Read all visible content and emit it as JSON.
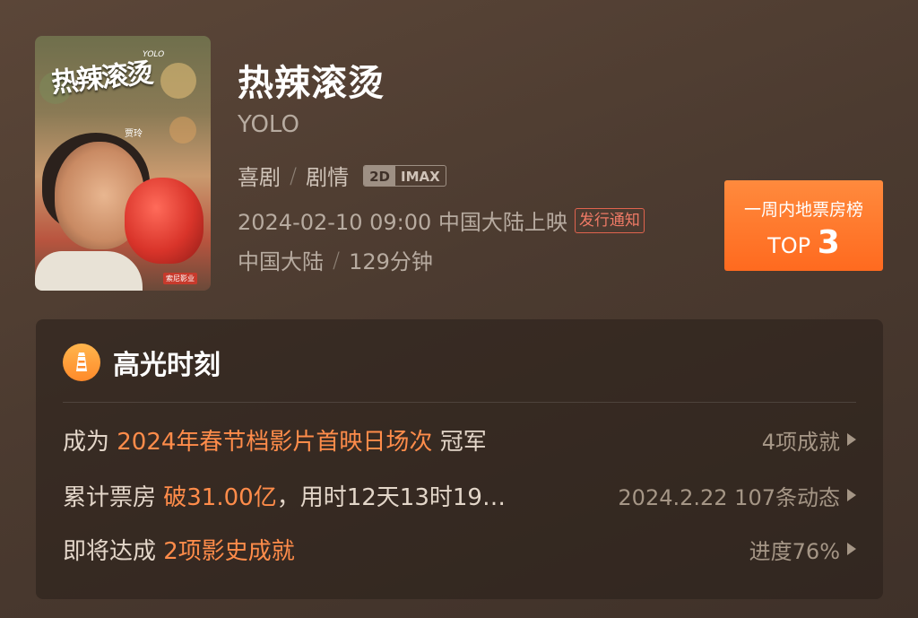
{
  "movie": {
    "title": "热辣滚烫",
    "english_title": "YOLO",
    "genres": [
      "喜剧",
      "剧情"
    ],
    "formats": [
      "2D",
      "IMAX"
    ],
    "release": "2024-02-10 09:00 中国大陆上映",
    "release_notice_label": "发行通知",
    "region": "中国大陆",
    "duration": "129分钟"
  },
  "poster": {
    "title_art": "热辣滚烫",
    "yolo_tag": "YOLO",
    "director": "贾玲",
    "stamp": "索尼影业"
  },
  "rank": {
    "title": "一周内地票房榜",
    "prefix": "TOP",
    "value": "3"
  },
  "highlights": {
    "title": "高光时刻",
    "items": [
      {
        "prefix": "成为 ",
        "accent": "2024年春节档影片首映日场次",
        "suffix": " 冠军",
        "right": "4项成就"
      },
      {
        "prefix": "累计票房 ",
        "accent": "破31.00亿",
        "suffix": "，用时12天13时19…",
        "right": "2024.2.22 107条动态"
      },
      {
        "prefix": "即将达成 ",
        "accent": "2项影史成就",
        "suffix": "",
        "right": "进度76%"
      }
    ]
  },
  "colors": {
    "accent": "#ff8c4a",
    "rank_badge": "#ff7a2a",
    "background": "#4a3a2f"
  }
}
